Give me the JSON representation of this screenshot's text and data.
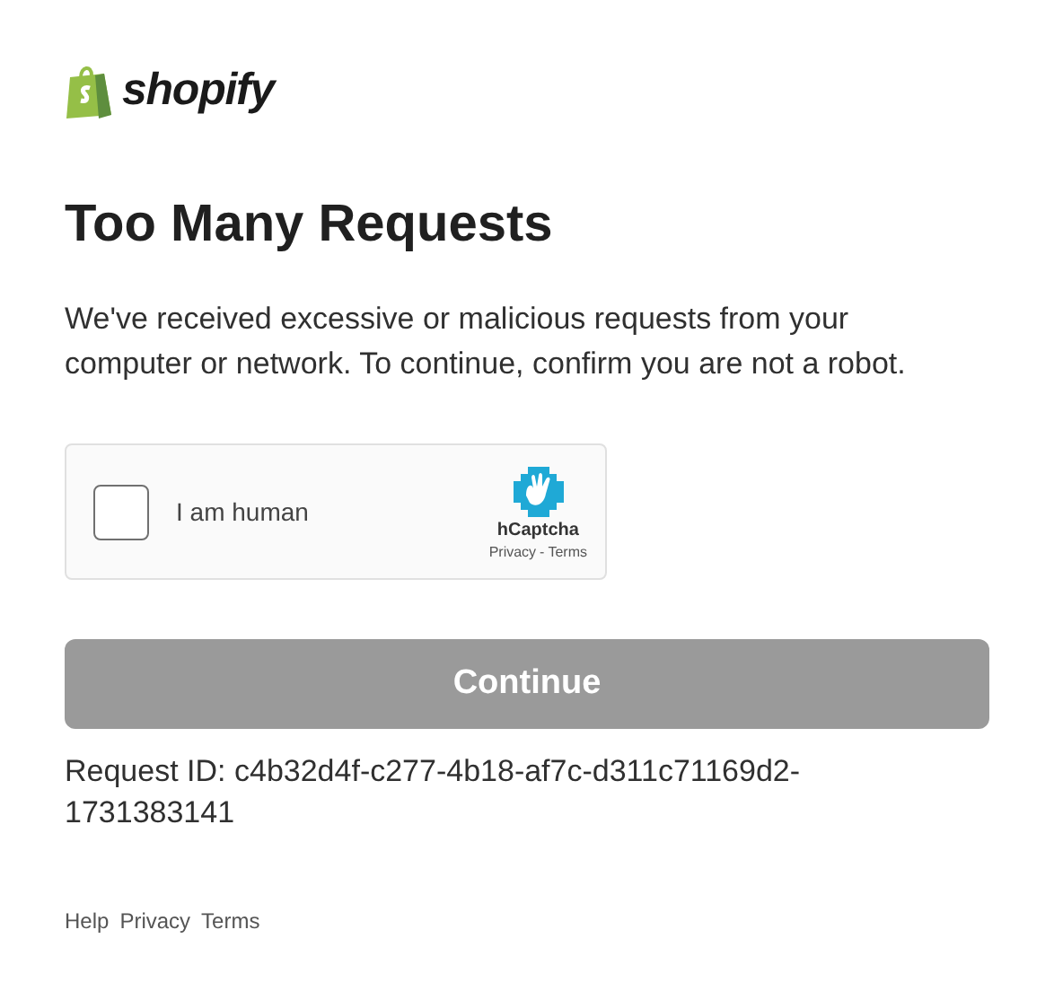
{
  "logo": {
    "text": "shopify"
  },
  "title": "Too Many Requests",
  "message": "We've received excessive or malicious requests from your computer or network. To continue, confirm you are not a robot.",
  "captcha": {
    "label": "I am human",
    "checked": false,
    "brand": "hCaptcha",
    "links": [
      "Privacy",
      "Terms"
    ],
    "separator": "-"
  },
  "continue_button": {
    "label": "Continue",
    "disabled": true
  },
  "request_id": "Request ID: c4b32d4f-c277-4b18-af7c-d311c71169d2-1731383141",
  "footer_links": [
    "Help",
    "Privacy",
    "Terms"
  ]
}
